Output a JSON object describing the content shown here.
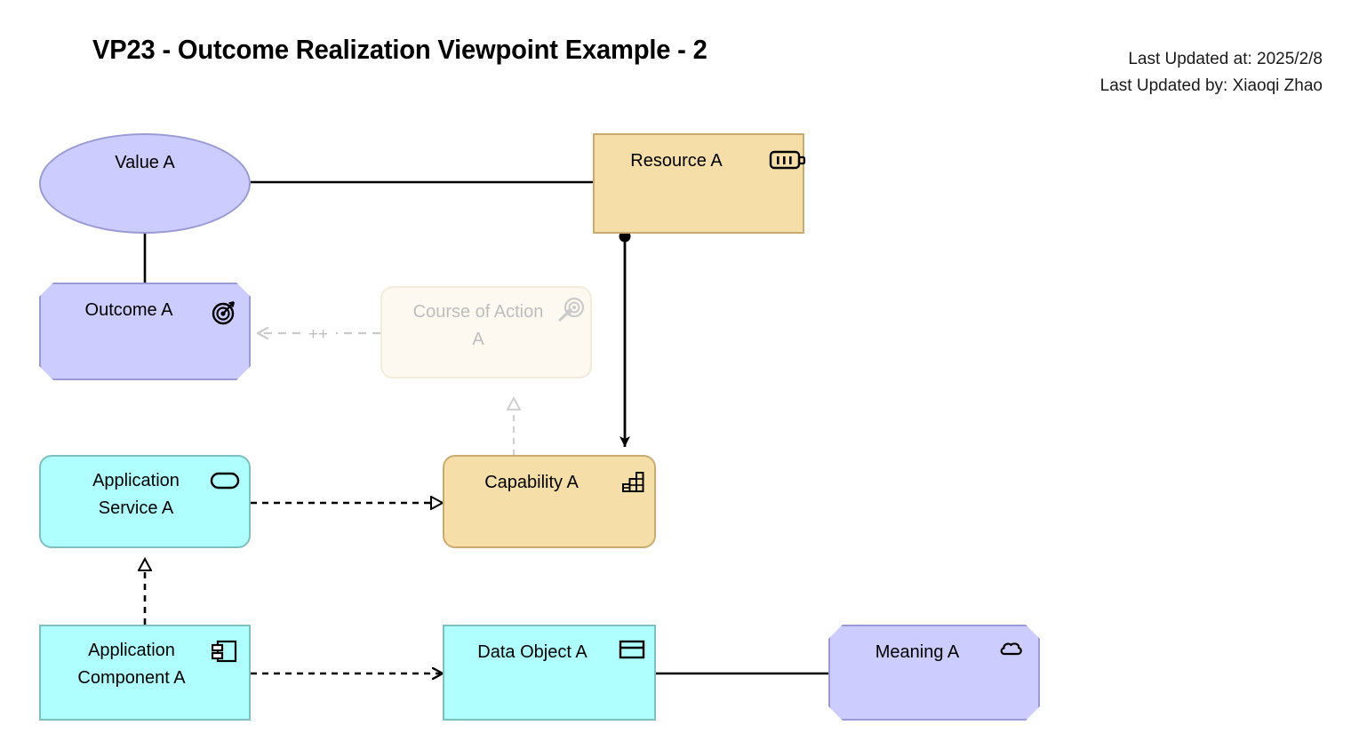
{
  "header": {
    "title": "VP23 - Outcome Realization Viewpoint Example - 2",
    "last_updated_at": "Last Updated at: 2025/2/8",
    "last_updated_by": "Last Updated by: Xiaoqi Zhao"
  },
  "palette": {
    "motivation_fill": "#CCCCFF",
    "motivation_stroke": "#9A9AD4",
    "strategy_fill": "#F5DEA8",
    "strategy_stroke": "#C9AB72",
    "application_fill": "#AFFFFF",
    "application_stroke": "#7FBFBF",
    "faded_fill": "#FBF0D9",
    "line": "#000000",
    "faded_line": "#A0A0A0",
    "background": "#FFFFFF"
  },
  "nodes": {
    "value_a": {
      "label": "Value A",
      "icon": "ellipse-value-icon",
      "type": "value"
    },
    "outcome_a": {
      "label": "Outcome A",
      "icon": "target-bullseye-icon",
      "type": "outcome"
    },
    "course_action_a": {
      "label": "Course of Action A",
      "icon": "target-arrow-icon",
      "type": "course-of-action",
      "state": "faded"
    },
    "resource_a": {
      "label": "Resource A",
      "icon": "battery-icon",
      "type": "resource"
    },
    "capability_a": {
      "label": "Capability A",
      "icon": "stairs-bars-icon",
      "type": "capability"
    },
    "app_service_a": {
      "label": "Application Service A",
      "icon": "rounded-service-icon",
      "type": "application-service"
    },
    "app_component_a": {
      "label": "Application Component A",
      "icon": "component-icon",
      "type": "application-component"
    },
    "data_object_a": {
      "label": "Data Object A",
      "icon": "data-object-icon",
      "type": "data-object"
    },
    "meaning_a": {
      "label": "Meaning A",
      "icon": "cloud-meaning-icon",
      "type": "meaning"
    }
  },
  "edges": {
    "value_to_resource": {
      "kind": "association",
      "label": ""
    },
    "value_to_outcome": {
      "kind": "association",
      "label": ""
    },
    "course_action_to_outcome": {
      "kind": "influence",
      "label": "++"
    },
    "resource_to_capability": {
      "kind": "assignment",
      "label": ""
    },
    "capability_to_course": {
      "kind": "realization",
      "label": ""
    },
    "app_service_to_capability": {
      "kind": "realization",
      "label": ""
    },
    "app_component_to_service": {
      "kind": "realization",
      "label": ""
    },
    "app_component_to_data": {
      "kind": "access",
      "label": ""
    },
    "data_to_meaning": {
      "kind": "association",
      "label": ""
    }
  }
}
